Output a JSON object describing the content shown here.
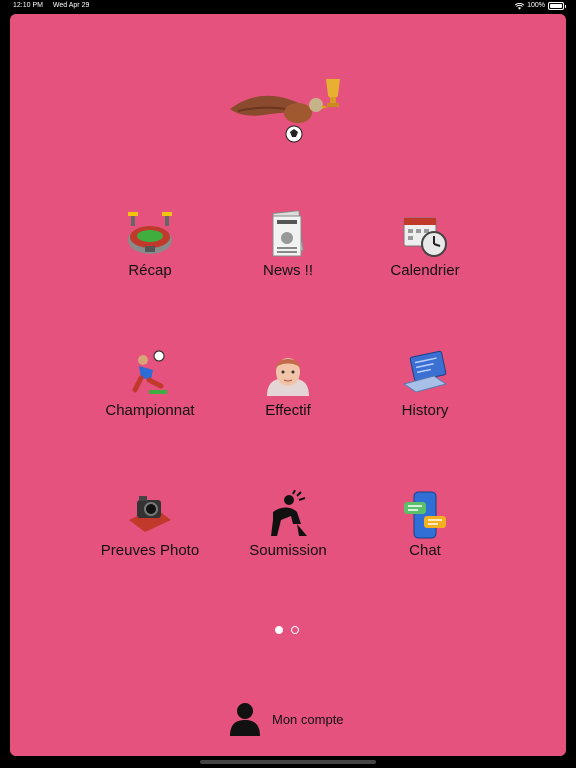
{
  "status_bar": {
    "time": "12:10 PM",
    "date": "Wed Apr 29",
    "battery": "100%"
  },
  "menu": [
    {
      "label": "Récap",
      "icon": "stadium-icon"
    },
    {
      "label": "News !!",
      "icon": "newspaper-icon"
    },
    {
      "label": "Calendrier",
      "icon": "calendar-clock-icon"
    },
    {
      "label": "Championnat",
      "icon": "soccer-player-icon"
    },
    {
      "label": "Effectif",
      "icon": "person-face-icon"
    },
    {
      "label": "History",
      "icon": "laptop-icon"
    },
    {
      "label": "Preuves Photo",
      "icon": "camera-icon"
    },
    {
      "label": "Soumission",
      "icon": "kneeling-submission-icon"
    },
    {
      "label": "Chat",
      "icon": "chat-phone-icon"
    }
  ],
  "pager": {
    "pages": 2,
    "current": 1
  },
  "account": {
    "label": "Mon compte"
  },
  "colors": {
    "background": "#e6527e",
    "text": "#111111"
  }
}
